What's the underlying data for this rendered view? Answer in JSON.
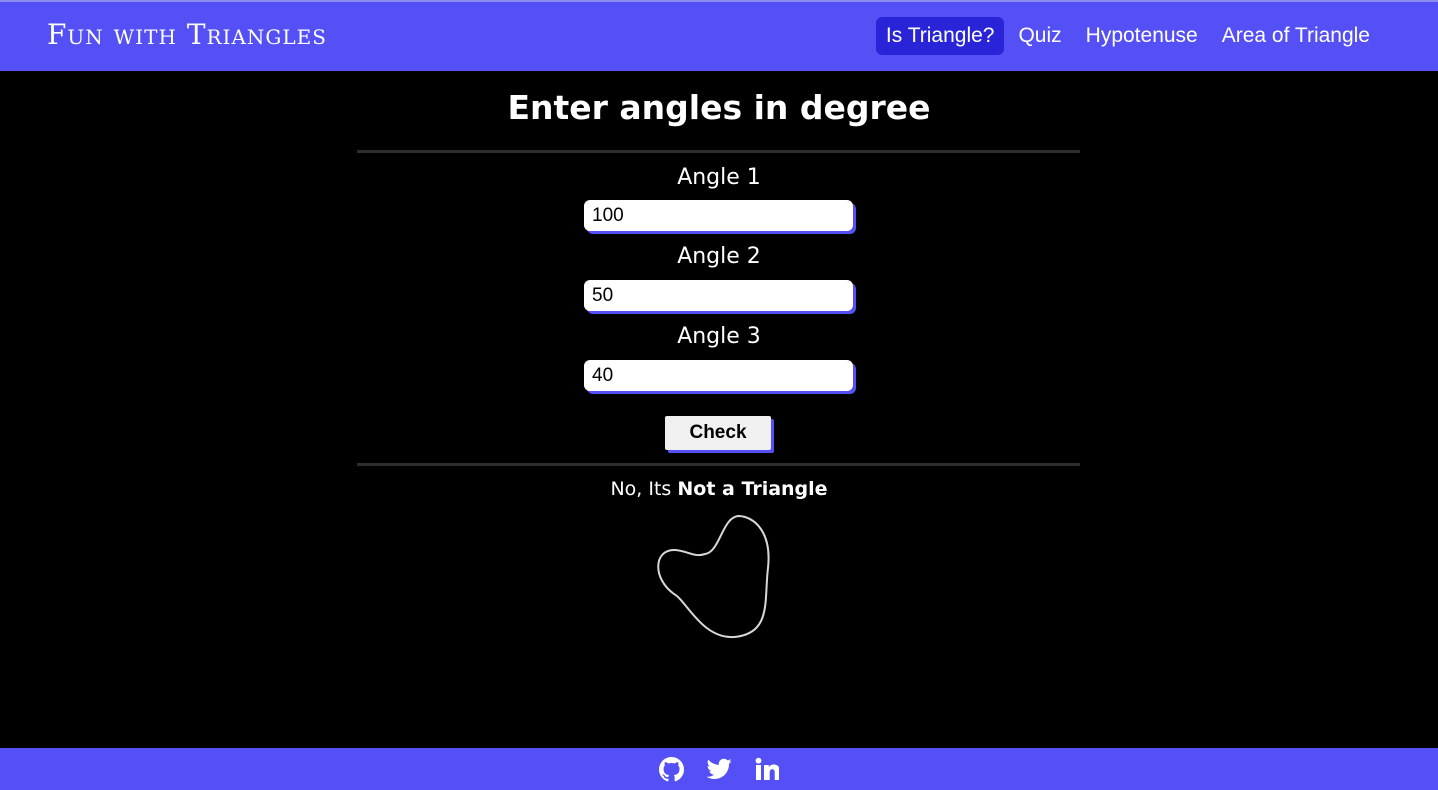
{
  "navbar": {
    "brand": "Fun with Triangles",
    "links": [
      {
        "label": "Is Triangle?",
        "active": true
      },
      {
        "label": "Quiz",
        "active": false
      },
      {
        "label": "Hypotenuse",
        "active": false
      },
      {
        "label": "Area of Triangle",
        "active": false
      }
    ]
  },
  "main": {
    "heading": "Enter angles in degree",
    "inputs": [
      {
        "label": "Angle 1",
        "value": "100"
      },
      {
        "label": "Angle 2",
        "value": "50"
      },
      {
        "label": "Angle 3",
        "value": "40"
      }
    ],
    "check_label": "Check",
    "result_prefix": "No, Its ",
    "result_emphasis": "Not a Triangle"
  },
  "footer": {
    "icons": [
      "github-icon",
      "twitter-icon",
      "linkedin-icon"
    ]
  },
  "colors": {
    "accent": "#5550f5",
    "active_link": "#2a24d8",
    "background": "#000000"
  }
}
